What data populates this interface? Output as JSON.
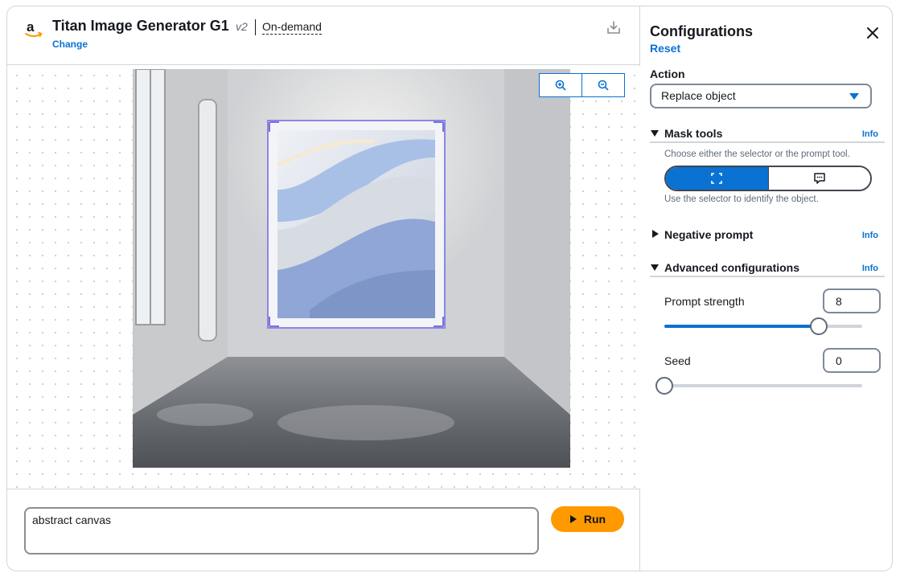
{
  "header": {
    "title": "Titan Image Generator G1",
    "version": "v2",
    "mode": "On-demand",
    "change_label": "Change"
  },
  "canvas": {
    "image_alt": "Gallery room with abstract canvas painting",
    "zoom_in_icon": "zoom-in-icon",
    "zoom_out_icon": "zoom-out-icon"
  },
  "prompt": {
    "value": "abstract canvas",
    "run_label": "Run"
  },
  "config": {
    "title": "Configurations",
    "reset_label": "Reset",
    "action_label": "Action",
    "action_value": "Replace object",
    "mask_tools": {
      "label": "Mask tools",
      "info": "Info",
      "hint_top": "Choose either the selector or the prompt tool.",
      "hint_bottom": "Use the selector to identify the object.",
      "options": [
        "selector-icon",
        "prompt-tool-icon"
      ],
      "selected": 0
    },
    "negative_prompt": {
      "label": "Negative prompt",
      "info": "Info"
    },
    "advanced": {
      "label": "Advanced configurations",
      "info": "Info",
      "prompt_strength": {
        "label": "Prompt strength",
        "value": "8",
        "fraction": 0.78
      },
      "seed": {
        "label": "Seed",
        "value": "0",
        "fraction": 0
      }
    }
  },
  "colors": {
    "accent": "#0972d3",
    "run_button": "#ff9900",
    "text": "#16191f"
  }
}
